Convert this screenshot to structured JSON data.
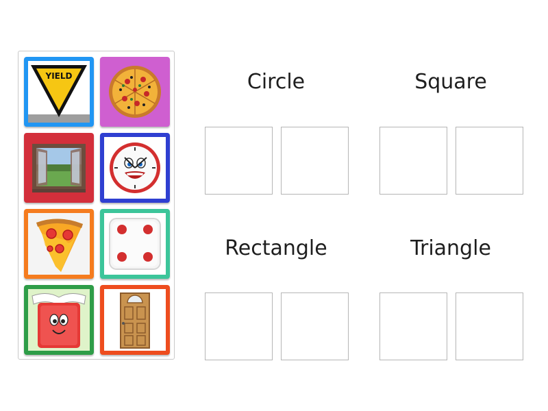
{
  "tray": {
    "cards": [
      {
        "name": "yield-sign-card",
        "icon": "yield-sign-icon",
        "sign_text": "YIELD",
        "color": "#2196f3"
      },
      {
        "name": "pizza-card",
        "icon": "pizza-icon",
        "color": "#cf5fd0"
      },
      {
        "name": "window-card",
        "icon": "window-icon",
        "color": "#d32f3b"
      },
      {
        "name": "clock-card",
        "icon": "clock-icon",
        "color": "#2f3fd1"
      },
      {
        "name": "pizza-slice-card",
        "icon": "pizza-slice-icon",
        "color": "#f57c1f"
      },
      {
        "name": "dice-card",
        "icon": "dice-icon",
        "color": "#3cc59a"
      },
      {
        "name": "book-card",
        "icon": "book-icon",
        "color": "#2e9d48"
      },
      {
        "name": "door-card",
        "icon": "door-icon",
        "color": "#ee4d1e"
      }
    ]
  },
  "groups": [
    {
      "title": "Circle"
    },
    {
      "title": "Square"
    },
    {
      "title": "Rectangle"
    },
    {
      "title": "Triangle"
    }
  ]
}
